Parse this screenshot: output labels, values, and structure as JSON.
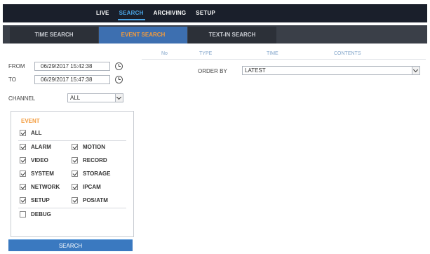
{
  "topnav": [
    "LIVE",
    "SEARCH",
    "ARCHIVING",
    "SETUP"
  ],
  "topnav_active": "SEARCH",
  "tabs": [
    "TIME SEARCH",
    "EVENT SEARCH",
    "TEXT-IN SEARCH"
  ],
  "tabs_active": "EVENT SEARCH",
  "filters": {
    "from_label": "FROM",
    "from_value": "06/29/2017 15:42:38",
    "to_label": "TO",
    "to_value": "06/29/2017 15:47:38",
    "channel_label": "CHANNEL",
    "channel_value": "ALL"
  },
  "event": {
    "title": "EVENT",
    "all_label": "ALL",
    "all_checked": true,
    "items": [
      {
        "label": "ALARM",
        "checked": true
      },
      {
        "label": "MOTION",
        "checked": true
      },
      {
        "label": "VIDEO",
        "checked": true
      },
      {
        "label": "RECORD",
        "checked": true
      },
      {
        "label": "SYSTEM",
        "checked": true
      },
      {
        "label": "STORAGE",
        "checked": true
      },
      {
        "label": "NETWORK",
        "checked": true
      },
      {
        "label": "IPCAM",
        "checked": true
      },
      {
        "label": "SETUP",
        "checked": true
      },
      {
        "label": "POS/ATM",
        "checked": true
      }
    ],
    "debug_label": "DEBUG",
    "debug_checked": false
  },
  "search_button": "SEARCH",
  "results": {
    "columns": [
      "No",
      "TYPE",
      "TIME",
      "CONTENTS"
    ],
    "order_by_label": "ORDER BY",
    "order_by_value": "LATEST"
  },
  "colors": {
    "topbar_bg": "#1a1f2b",
    "accent_blue": "#4aa6e8",
    "accent_orange": "#f39b3c",
    "button_blue": "#3a79c0"
  }
}
